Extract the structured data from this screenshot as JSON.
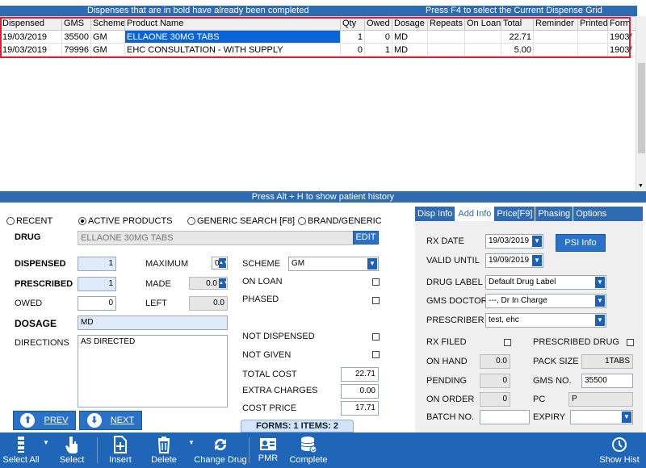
{
  "grid": {
    "banner_left": "Dispenses that are in bold have already been completed",
    "banner_right": "Press F4 to select the Current Dispense Grid",
    "columns": [
      "Dispensed",
      "GMS",
      "Scheme",
      "Product Name",
      "Qty",
      "Owed",
      "Dosage",
      "Repeats",
      "On Loan",
      "Total",
      "Reminder",
      "Printed",
      "Form"
    ],
    "rows": [
      [
        "19/03/2019",
        "35500",
        "GM",
        "ELLAONE 30MG TABS",
        "1",
        "0",
        "MD",
        "",
        "",
        "22.71",
        "",
        "",
        "1903/"
      ],
      [
        "19/03/2019",
        "79996",
        "GM",
        "EHC CONSULTATION - WITH SUPPLY",
        "0",
        "1",
        "MD",
        "",
        "",
        "5.00",
        "",
        "",
        "1903/"
      ]
    ]
  },
  "history_banner": "Press Alt + H to show patient history",
  "search": {
    "recent": "RECENT",
    "active": "ACTIVE PRODUCTS",
    "generic": "GENERIC SEARCH [F8]",
    "brand": "BRAND/GENERIC"
  },
  "drug": {
    "label": "DRUG",
    "value": "ELLAONE 30MG TABS",
    "edit": "EDIT"
  },
  "fields": {
    "dispensed_label": "DISPENSED",
    "dispensed": "1",
    "prescribed_label": "PRESCRIBED",
    "prescribed": "1",
    "owed_label": "OWED",
    "owed": "0",
    "dosage_label": "DOSAGE",
    "dosage": "MD",
    "directions_label": "DIRECTIONS",
    "directions": "AS DIRECTED",
    "maximum_label": "MAXIMUM",
    "maximum": "0",
    "made_label": "MADE",
    "made": "0.0",
    "left_label": "LEFT",
    "left": "0.0",
    "scheme_label": "SCHEME",
    "scheme": "GM",
    "on_loan_label": "ON LOAN",
    "phased_label": "PHASED",
    "not_dispensed_label": "NOT DISPENSED",
    "not_given_label": "NOT GIVEN",
    "total_cost_label": "TOTAL COST",
    "total_cost": "22.71",
    "extra_charges_label": "EXTRA CHARGES",
    "extra_charges": "0.00",
    "cost_price_label": "COST PRICE",
    "cost_price": "17.71"
  },
  "nav": {
    "prev": "PREV",
    "next": "NEXT",
    "forms": "FORMS: 1  ITEMS: 2"
  },
  "tabs": [
    "Disp Info",
    "Add Info",
    "Price[F9]",
    "Phasing",
    "Options"
  ],
  "info": {
    "rx_date_label": "RX DATE",
    "rx_date": "19/03/2019",
    "valid_until_label": "VALID UNTIL",
    "valid_until": "19/09/2019",
    "psi_button": "PSI Info",
    "drug_label_label": "DRUG LABEL",
    "drug_label": "Default Drug Label",
    "gms_doctor_label": "GMS DOCTOR",
    "gms_doctor": "---, Dr In Charge",
    "prescriber_label": "PRESCRIBER",
    "prescriber": "test, ehc",
    "rx_filed_label": "RX FILED",
    "prescribed_drug_label": "PRESCRIBED DRUG",
    "on_hand_label": "ON HAND",
    "on_hand": "0.0",
    "pack_size_label": "PACK SIZE",
    "pack_size": "1TABS",
    "pending_label": "PENDING",
    "pending": "0",
    "gms_no_label": "GMS NO.",
    "gms_no": "35500",
    "on_order_label": "ON ORDER",
    "on_order": "0",
    "pc_label": "PC",
    "pc": "P",
    "batch_label": "BATCH NO.",
    "expiry_label": "EXPIRY"
  },
  "toolbar": {
    "select_all": "Select All",
    "select": "Select",
    "insert": "Insert",
    "delete": "Delete",
    "change_drug": "Change Drug",
    "pmr": "PMR",
    "complete": "Complete",
    "show_hist": "Show Hist"
  }
}
